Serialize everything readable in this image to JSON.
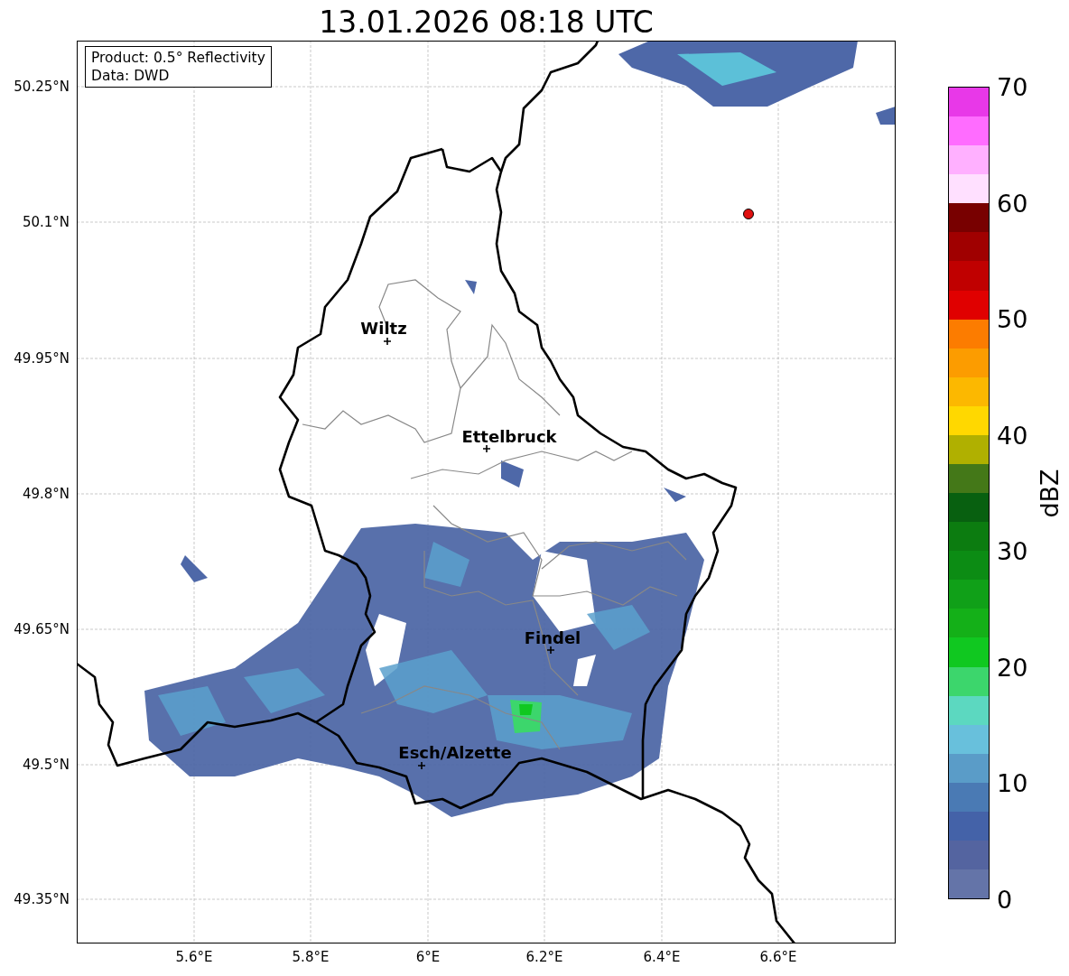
{
  "title": "13.01.2026 08:18 UTC",
  "info_box": {
    "lines": [
      "Product: 0.5° Reflectivity",
      "Data: DWD"
    ]
  },
  "map": {
    "places": [
      {
        "name": "Wiltz"
      },
      {
        "name": "Ettelbruck"
      },
      {
        "name": "Findel"
      },
      {
        "name": "Esch/Alzette"
      }
    ],
    "y_ticks": [
      "50.25°N",
      "50.1°N",
      "49.95°N",
      "49.8°N",
      "49.65°N",
      "49.5°N",
      "49.35°N"
    ],
    "x_ticks": [
      "5.6°E",
      "5.8°E",
      "6°E",
      "6.2°E",
      "6.4°E",
      "6.6°E"
    ]
  },
  "colorbar": {
    "label": "dBZ",
    "ticks": [
      "70",
      "60",
      "50",
      "40",
      "30",
      "20",
      "10",
      "0"
    ]
  }
}
